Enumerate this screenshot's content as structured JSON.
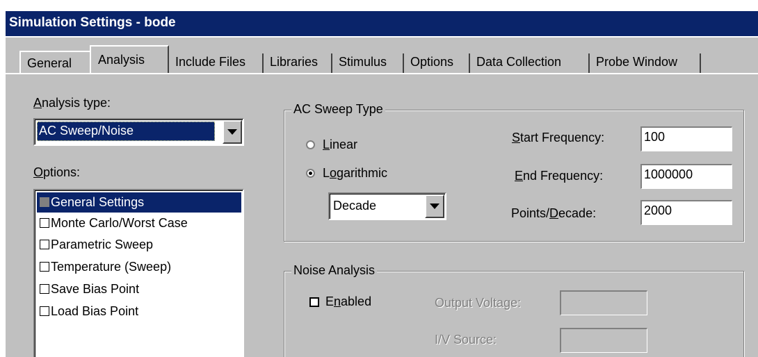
{
  "window": {
    "title": "Simulation Settings - bode"
  },
  "tabs": [
    {
      "label": "General"
    },
    {
      "label": "Analysis"
    },
    {
      "label": "Include Files"
    },
    {
      "label": "Libraries"
    },
    {
      "label": "Stimulus"
    },
    {
      "label": "Options"
    },
    {
      "label": "Data Collection"
    },
    {
      "label": "Probe Window"
    }
  ],
  "analysis": {
    "type_label_first": "A",
    "type_label_rest": "nalysis type:",
    "type_value": "AC Sweep/Noise",
    "options_label_first": "O",
    "options_label_rest": "ptions:",
    "options": [
      {
        "label": "General Settings",
        "checked": true,
        "selected": true
      },
      {
        "label": "Monte Carlo/Worst Case",
        "checked": false
      },
      {
        "label": "Parametric Sweep",
        "checked": false
      },
      {
        "label": "Temperature (Sweep)",
        "checked": false
      },
      {
        "label": "Save Bias Point",
        "checked": false
      },
      {
        "label": "Load Bias Point",
        "checked": false
      }
    ]
  },
  "ac_sweep": {
    "group_title": "AC Sweep Type",
    "linear_first": "L",
    "linear_rest": "inear",
    "log_pre": "L",
    "log_u": "o",
    "log_rest": "garithmic",
    "selected": "Logarithmic",
    "log_type": "Decade",
    "start_first": "S",
    "start_rest": "tart Frequency:",
    "start_value": "100",
    "end_first": "E",
    "end_rest": "nd Frequency:",
    "end_value": "1000000",
    "points_pre": "Points/",
    "points_u": "D",
    "points_rest": "ecade:",
    "points_value": "2000"
  },
  "noise": {
    "group_title": "Noise Analysis",
    "enabled_pre": "E",
    "enabled_u": "n",
    "enabled_rest": "abled",
    "enabled": false,
    "output_voltage_label": "Output Voltage:",
    "output_voltage_value": "",
    "iv_source_label": "I/V Source:",
    "iv_source_value": ""
  },
  "colors": {
    "titlebar": "#0a246a",
    "face": "#c0c0c0",
    "selection": "#0a246a"
  }
}
